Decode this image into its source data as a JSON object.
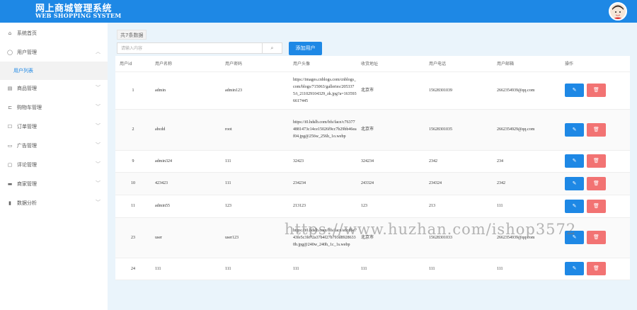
{
  "header": {
    "title": "网上商城管理系统",
    "subtitle": "WEB SHOPPING SYSTEM",
    "brand_color": "#1e88e5"
  },
  "sidebar": {
    "items": [
      {
        "label": "系统首页",
        "icon": "home-icon"
      },
      {
        "label": "用户管理",
        "icon": "user-icon",
        "expanded": true
      },
      {
        "label": "商品管理",
        "icon": "goods-icon"
      },
      {
        "label": "购物车管理",
        "icon": "cart-icon"
      },
      {
        "label": "订单管理",
        "icon": "order-icon"
      },
      {
        "label": "广告管理",
        "icon": "ad-icon"
      },
      {
        "label": "评论管理",
        "icon": "comment-icon"
      },
      {
        "label": "商家管理",
        "icon": "store-icon"
      },
      {
        "label": "数据分析",
        "icon": "chart-icon"
      }
    ],
    "subitem": {
      "label": "用户列表"
    }
  },
  "toolbar": {
    "count_label": "共7条数据",
    "search_placeholder": "请输入内容",
    "add_label": "添加用户"
  },
  "table": {
    "columns": [
      "用户id",
      "用户名称",
      "用户密码",
      "用户头像",
      "收货地址",
      "用户电话",
      "用户邮箱",
      "操作"
    ],
    "rows": [
      {
        "id": "1",
        "name": "admin",
        "password": "admin123",
        "avatar": "https://images.cnblogs.com/cnblogs_com/blogs/715063/galleries/2053375/t_211029104329_zk.jpg?a=1635936617445",
        "address": "北京市",
        "phone": "15628301039",
        "email": "2662354939@qq.com"
      },
      {
        "id": "2",
        "name": "abcdd",
        "password": "root",
        "avatar": "https://i0.hdslb.com/bfs/face/c763774881473c14ce15026f9cc7b29bb46eaf04.jpg@256w_256h_1o.webp",
        "address": "北京市",
        "phone": "15628301035",
        "email": "2662354929@qq.com"
      },
      {
        "id": "9",
        "name": "admin324",
        "password": "111",
        "avatar": "32423",
        "address": "324234",
        "phone": "2342",
        "email": "234"
      },
      {
        "id": "10",
        "name": "423423",
        "password": "111",
        "avatar": "234234",
        "address": "243324",
        "phone": "234324",
        "email": "2342"
      },
      {
        "id": "11",
        "name": "admin55",
        "password": "123",
        "avatar": "213123",
        "address": "123",
        "phone": "213",
        "email": "111"
      },
      {
        "id": "23",
        "name": "user",
        "password": "user123",
        "avatar": "https://i0.hdslb.com/bfs/face/a6cd6e743fe5c3fc72a37b4f27b793d89286330b.jpg@240w_240h_1c_1s.webp",
        "address": "北京市",
        "phone": "15628301033",
        "email": "2662354939@qq.com"
      },
      {
        "id": "24",
        "name": "111",
        "password": "111",
        "avatar": "111",
        "address": "111",
        "phone": "111",
        "email": "111"
      }
    ]
  },
  "watermark": "https://www.huzhan.com/ishop3572"
}
